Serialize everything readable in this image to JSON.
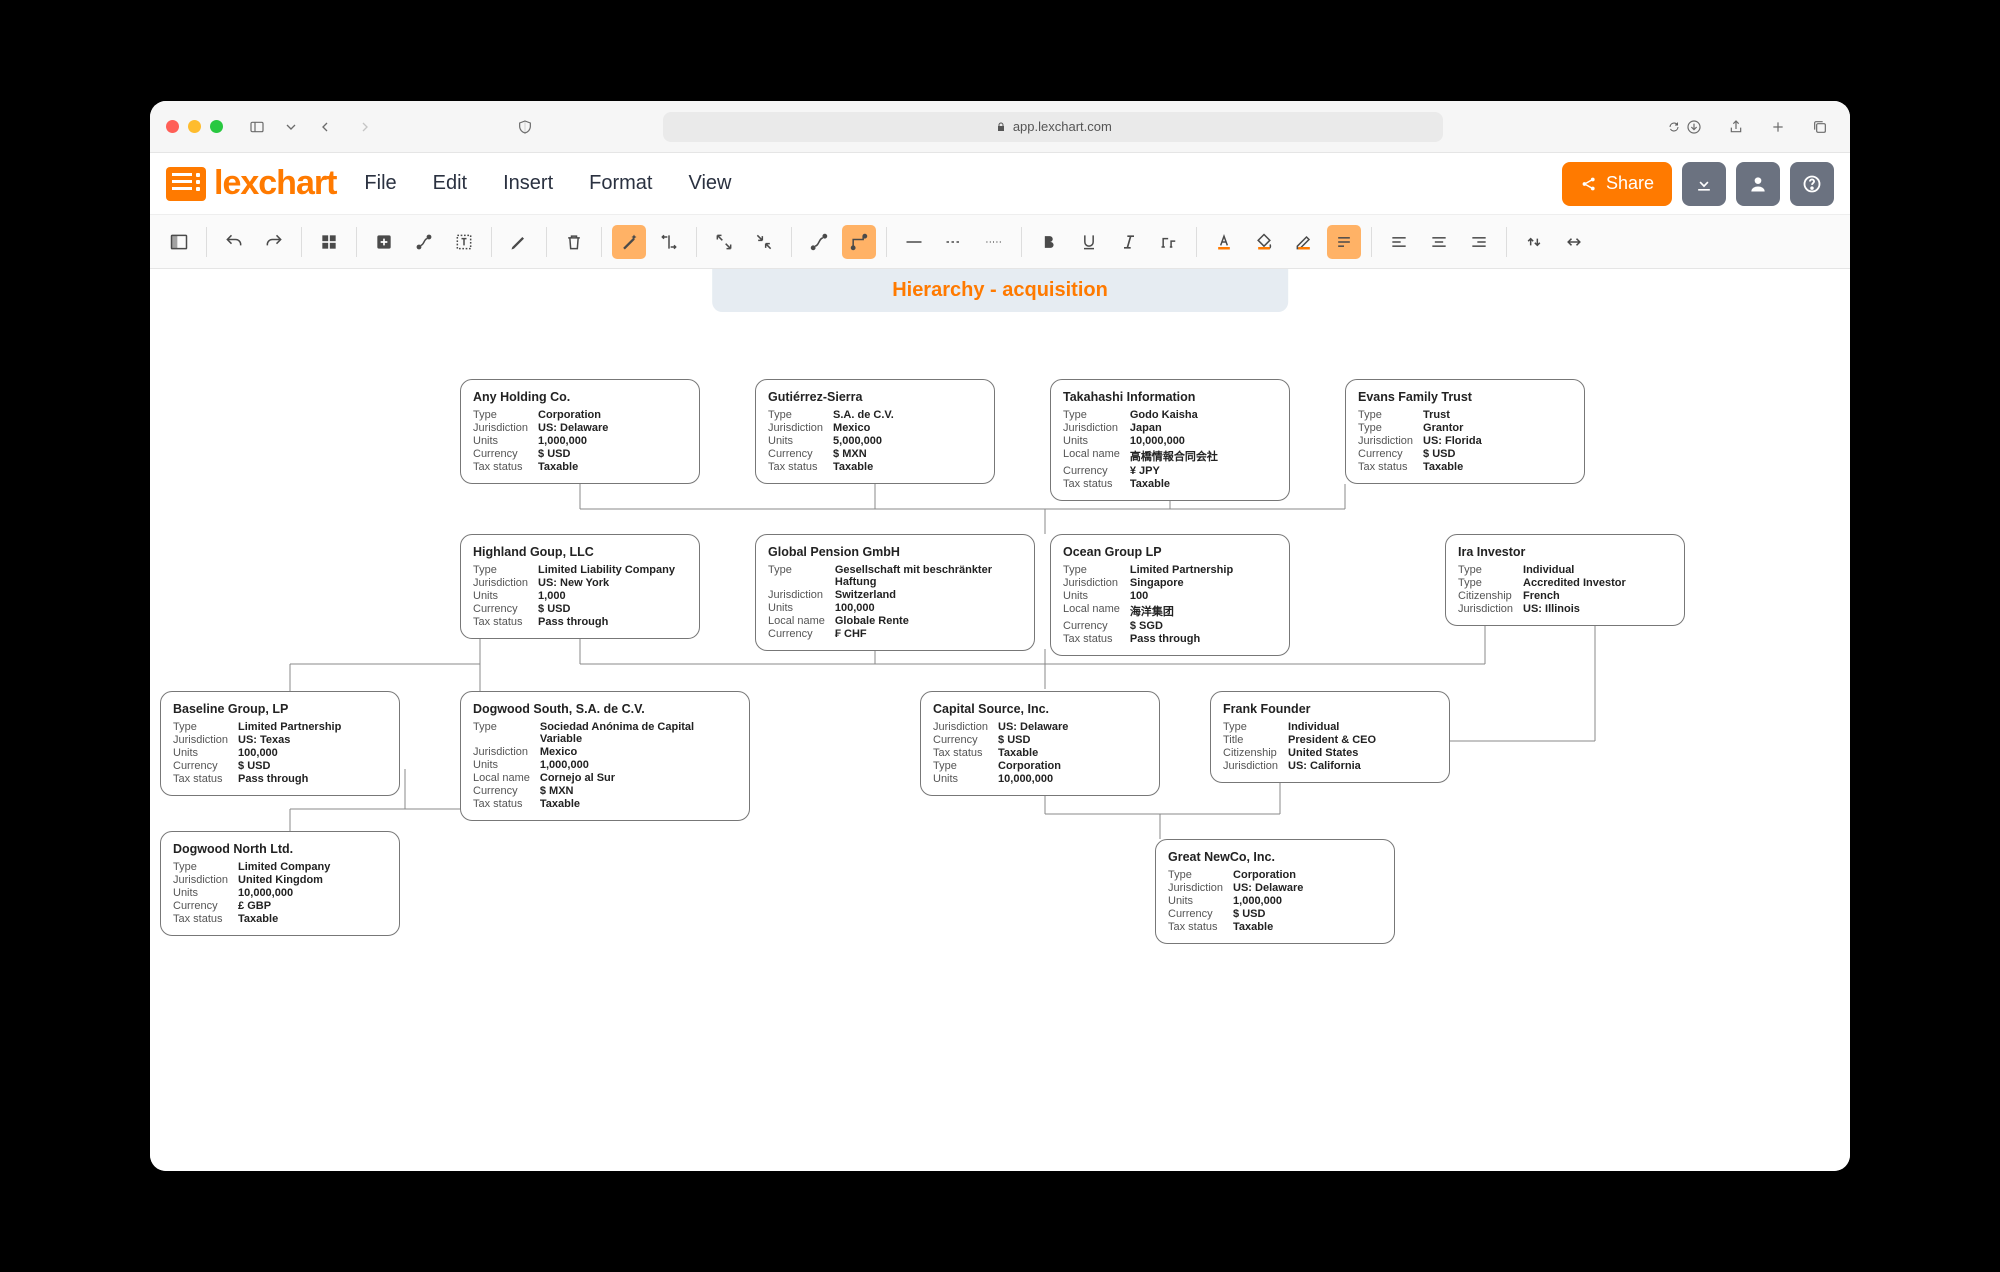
{
  "browser": {
    "url": "app.lexchart.com"
  },
  "app": {
    "logo_text": "lexchart"
  },
  "menu": [
    "File",
    "Edit",
    "Insert",
    "Format",
    "View"
  ],
  "share_label": "Share",
  "chart_title": "Hierarchy - acquisition",
  "nodes": {
    "any_holding": {
      "title": "Any Holding Co.",
      "fields": [
        [
          "Type",
          "Corporation"
        ],
        [
          "Jurisdiction",
          "US: Delaware"
        ],
        [
          "Units",
          "1,000,000"
        ],
        [
          "Currency",
          "$ USD"
        ],
        [
          "Tax status",
          "Taxable"
        ]
      ]
    },
    "gutierrez": {
      "title": "Gutiérrez-Sierra",
      "fields": [
        [
          "Type",
          "S.A. de C.V."
        ],
        [
          "Jurisdiction",
          "Mexico"
        ],
        [
          "Units",
          "5,000,000"
        ],
        [
          "Currency",
          "$ MXN"
        ],
        [
          "Tax status",
          "Taxable"
        ]
      ]
    },
    "takahashi": {
      "title": "Takahashi Information",
      "fields": [
        [
          "Type",
          "Godo Kaisha"
        ],
        [
          "Jurisdiction",
          "Japan"
        ],
        [
          "Units",
          "10,000,000"
        ],
        [
          "Local name",
          "高橋情報合同会社"
        ],
        [
          "Currency",
          "¥ JPY"
        ],
        [
          "Tax status",
          "Taxable"
        ]
      ]
    },
    "evans": {
      "title": "Evans Family Trust",
      "fields": [
        [
          "Type",
          "Trust"
        ],
        [
          "Type",
          "Grantor"
        ],
        [
          "Jurisdiction",
          "US: Florida"
        ],
        [
          "Currency",
          "$ USD"
        ],
        [
          "Tax status",
          "Taxable"
        ]
      ]
    },
    "highland": {
      "title": "Highland Goup, LLC",
      "fields": [
        [
          "Type",
          "Limited Liability Company"
        ],
        [
          "Jurisdiction",
          "US: New York"
        ],
        [
          "Units",
          "1,000"
        ],
        [
          "Currency",
          "$ USD"
        ],
        [
          "Tax status",
          "Pass through"
        ]
      ]
    },
    "global": {
      "title": "Global Pension GmbH",
      "fields": [
        [
          "Type",
          "Gesellschaft mit beschränkter Haftung"
        ],
        [
          "Jurisdiction",
          "Switzerland"
        ],
        [
          "Units",
          "100,000"
        ],
        [
          "Local name",
          "Globale Rente"
        ],
        [
          "Currency",
          "₣ CHF"
        ]
      ]
    },
    "ocean": {
      "title": "Ocean Group LP",
      "fields": [
        [
          "Type",
          "Limited Partnership"
        ],
        [
          "Jurisdiction",
          "Singapore"
        ],
        [
          "Units",
          "100"
        ],
        [
          "Local name",
          "海洋集团"
        ],
        [
          "Currency",
          "$ SGD"
        ],
        [
          "Tax status",
          "Pass through"
        ]
      ]
    },
    "ira": {
      "title": "Ira Investor",
      "fields": [
        [
          "Type",
          "Individual"
        ],
        [
          "Type",
          "Accredited Investor"
        ],
        [
          "Citizenship",
          "French"
        ],
        [
          "Jurisdiction",
          "US: Illinois"
        ]
      ]
    },
    "baseline": {
      "title": "Baseline Group, LP",
      "fields": [
        [
          "Type",
          "Limited Partnership"
        ],
        [
          "Jurisdiction",
          "US: Texas"
        ],
        [
          "Units",
          "100,000"
        ],
        [
          "Currency",
          "$ USD"
        ],
        [
          "Tax status",
          "Pass through"
        ]
      ]
    },
    "dogwood_s": {
      "title": "Dogwood South, S.A. de C.V.",
      "fields": [
        [
          "Type",
          "Sociedad Anónima de Capital Variable"
        ],
        [
          "Jurisdiction",
          "Mexico"
        ],
        [
          "Units",
          "1,000,000"
        ],
        [
          "Local name",
          "Cornejo al Sur"
        ],
        [
          "Currency",
          "$ MXN"
        ],
        [
          "Tax status",
          "Taxable"
        ]
      ]
    },
    "capital": {
      "title": "Capital Source, Inc.",
      "fields": [
        [
          "Jurisdiction",
          "US: Delaware"
        ],
        [
          "Currency",
          "$ USD"
        ],
        [
          "Tax status",
          "Taxable"
        ],
        [
          "Type",
          "Corporation"
        ],
        [
          "Units",
          "10,000,000"
        ]
      ]
    },
    "frank": {
      "title": "Frank Founder",
      "fields": [
        [
          "Type",
          "Individual"
        ],
        [
          "Title",
          "President & CEO"
        ],
        [
          "Citizenship",
          "United States"
        ],
        [
          "Jurisdiction",
          "US: California"
        ]
      ]
    },
    "dogwood_n": {
      "title": "Dogwood North Ltd.",
      "fields": [
        [
          "Type",
          "Limited Company"
        ],
        [
          "Jurisdiction",
          "United Kingdom"
        ],
        [
          "Units",
          "10,000,000"
        ],
        [
          "Currency",
          "£ GBP"
        ],
        [
          "Tax status",
          "Taxable"
        ]
      ]
    },
    "newco": {
      "title": "Great NewCo, Inc.",
      "fields": [
        [
          "Type",
          "Corporation"
        ],
        [
          "Jurisdiction",
          "US: Delaware"
        ],
        [
          "Units",
          "1,000,000"
        ],
        [
          "Currency",
          "$ USD"
        ],
        [
          "Tax status",
          "Taxable"
        ]
      ]
    }
  }
}
